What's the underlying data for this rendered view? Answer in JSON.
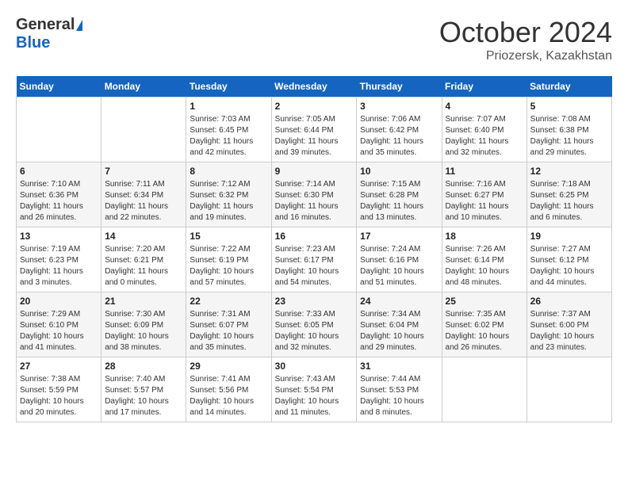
{
  "header": {
    "logo_general": "General",
    "logo_blue": "Blue",
    "month_title": "October 2024",
    "subtitle": "Priozersk, Kazakhstan"
  },
  "weekdays": [
    "Sunday",
    "Monday",
    "Tuesday",
    "Wednesday",
    "Thursday",
    "Friday",
    "Saturday"
  ],
  "weeks": [
    [
      null,
      null,
      {
        "day": 1,
        "sunrise": "7:03 AM",
        "sunset": "6:45 PM",
        "daylight": "11 hours and 42 minutes."
      },
      {
        "day": 2,
        "sunrise": "7:05 AM",
        "sunset": "6:44 PM",
        "daylight": "11 hours and 39 minutes."
      },
      {
        "day": 3,
        "sunrise": "7:06 AM",
        "sunset": "6:42 PM",
        "daylight": "11 hours and 35 minutes."
      },
      {
        "day": 4,
        "sunrise": "7:07 AM",
        "sunset": "6:40 PM",
        "daylight": "11 hours and 32 minutes."
      },
      {
        "day": 5,
        "sunrise": "7:08 AM",
        "sunset": "6:38 PM",
        "daylight": "11 hours and 29 minutes."
      }
    ],
    [
      {
        "day": 6,
        "sunrise": "7:10 AM",
        "sunset": "6:36 PM",
        "daylight": "11 hours and 26 minutes."
      },
      {
        "day": 7,
        "sunrise": "7:11 AM",
        "sunset": "6:34 PM",
        "daylight": "11 hours and 22 minutes."
      },
      {
        "day": 8,
        "sunrise": "7:12 AM",
        "sunset": "6:32 PM",
        "daylight": "11 hours and 19 minutes."
      },
      {
        "day": 9,
        "sunrise": "7:14 AM",
        "sunset": "6:30 PM",
        "daylight": "11 hours and 16 minutes."
      },
      {
        "day": 10,
        "sunrise": "7:15 AM",
        "sunset": "6:28 PM",
        "daylight": "11 hours and 13 minutes."
      },
      {
        "day": 11,
        "sunrise": "7:16 AM",
        "sunset": "6:27 PM",
        "daylight": "11 hours and 10 minutes."
      },
      {
        "day": 12,
        "sunrise": "7:18 AM",
        "sunset": "6:25 PM",
        "daylight": "11 hours and 6 minutes."
      }
    ],
    [
      {
        "day": 13,
        "sunrise": "7:19 AM",
        "sunset": "6:23 PM",
        "daylight": "11 hours and 3 minutes."
      },
      {
        "day": 14,
        "sunrise": "7:20 AM",
        "sunset": "6:21 PM",
        "daylight": "11 hours and 0 minutes."
      },
      {
        "day": 15,
        "sunrise": "7:22 AM",
        "sunset": "6:19 PM",
        "daylight": "10 hours and 57 minutes."
      },
      {
        "day": 16,
        "sunrise": "7:23 AM",
        "sunset": "6:17 PM",
        "daylight": "10 hours and 54 minutes."
      },
      {
        "day": 17,
        "sunrise": "7:24 AM",
        "sunset": "6:16 PM",
        "daylight": "10 hours and 51 minutes."
      },
      {
        "day": 18,
        "sunrise": "7:26 AM",
        "sunset": "6:14 PM",
        "daylight": "10 hours and 48 minutes."
      },
      {
        "day": 19,
        "sunrise": "7:27 AM",
        "sunset": "6:12 PM",
        "daylight": "10 hours and 44 minutes."
      }
    ],
    [
      {
        "day": 20,
        "sunrise": "7:29 AM",
        "sunset": "6:10 PM",
        "daylight": "10 hours and 41 minutes."
      },
      {
        "day": 21,
        "sunrise": "7:30 AM",
        "sunset": "6:09 PM",
        "daylight": "10 hours and 38 minutes."
      },
      {
        "day": 22,
        "sunrise": "7:31 AM",
        "sunset": "6:07 PM",
        "daylight": "10 hours and 35 minutes."
      },
      {
        "day": 23,
        "sunrise": "7:33 AM",
        "sunset": "6:05 PM",
        "daylight": "10 hours and 32 minutes."
      },
      {
        "day": 24,
        "sunrise": "7:34 AM",
        "sunset": "6:04 PM",
        "daylight": "10 hours and 29 minutes."
      },
      {
        "day": 25,
        "sunrise": "7:35 AM",
        "sunset": "6:02 PM",
        "daylight": "10 hours and 26 minutes."
      },
      {
        "day": 26,
        "sunrise": "7:37 AM",
        "sunset": "6:00 PM",
        "daylight": "10 hours and 23 minutes."
      }
    ],
    [
      {
        "day": 27,
        "sunrise": "7:38 AM",
        "sunset": "5:59 PM",
        "daylight": "10 hours and 20 minutes."
      },
      {
        "day": 28,
        "sunrise": "7:40 AM",
        "sunset": "5:57 PM",
        "daylight": "10 hours and 17 minutes."
      },
      {
        "day": 29,
        "sunrise": "7:41 AM",
        "sunset": "5:56 PM",
        "daylight": "10 hours and 14 minutes."
      },
      {
        "day": 30,
        "sunrise": "7:43 AM",
        "sunset": "5:54 PM",
        "daylight": "10 hours and 11 minutes."
      },
      {
        "day": 31,
        "sunrise": "7:44 AM",
        "sunset": "5:53 PM",
        "daylight": "10 hours and 8 minutes."
      },
      null,
      null
    ]
  ],
  "labels": {
    "sunrise": "Sunrise:",
    "sunset": "Sunset:",
    "daylight": "Daylight:"
  }
}
